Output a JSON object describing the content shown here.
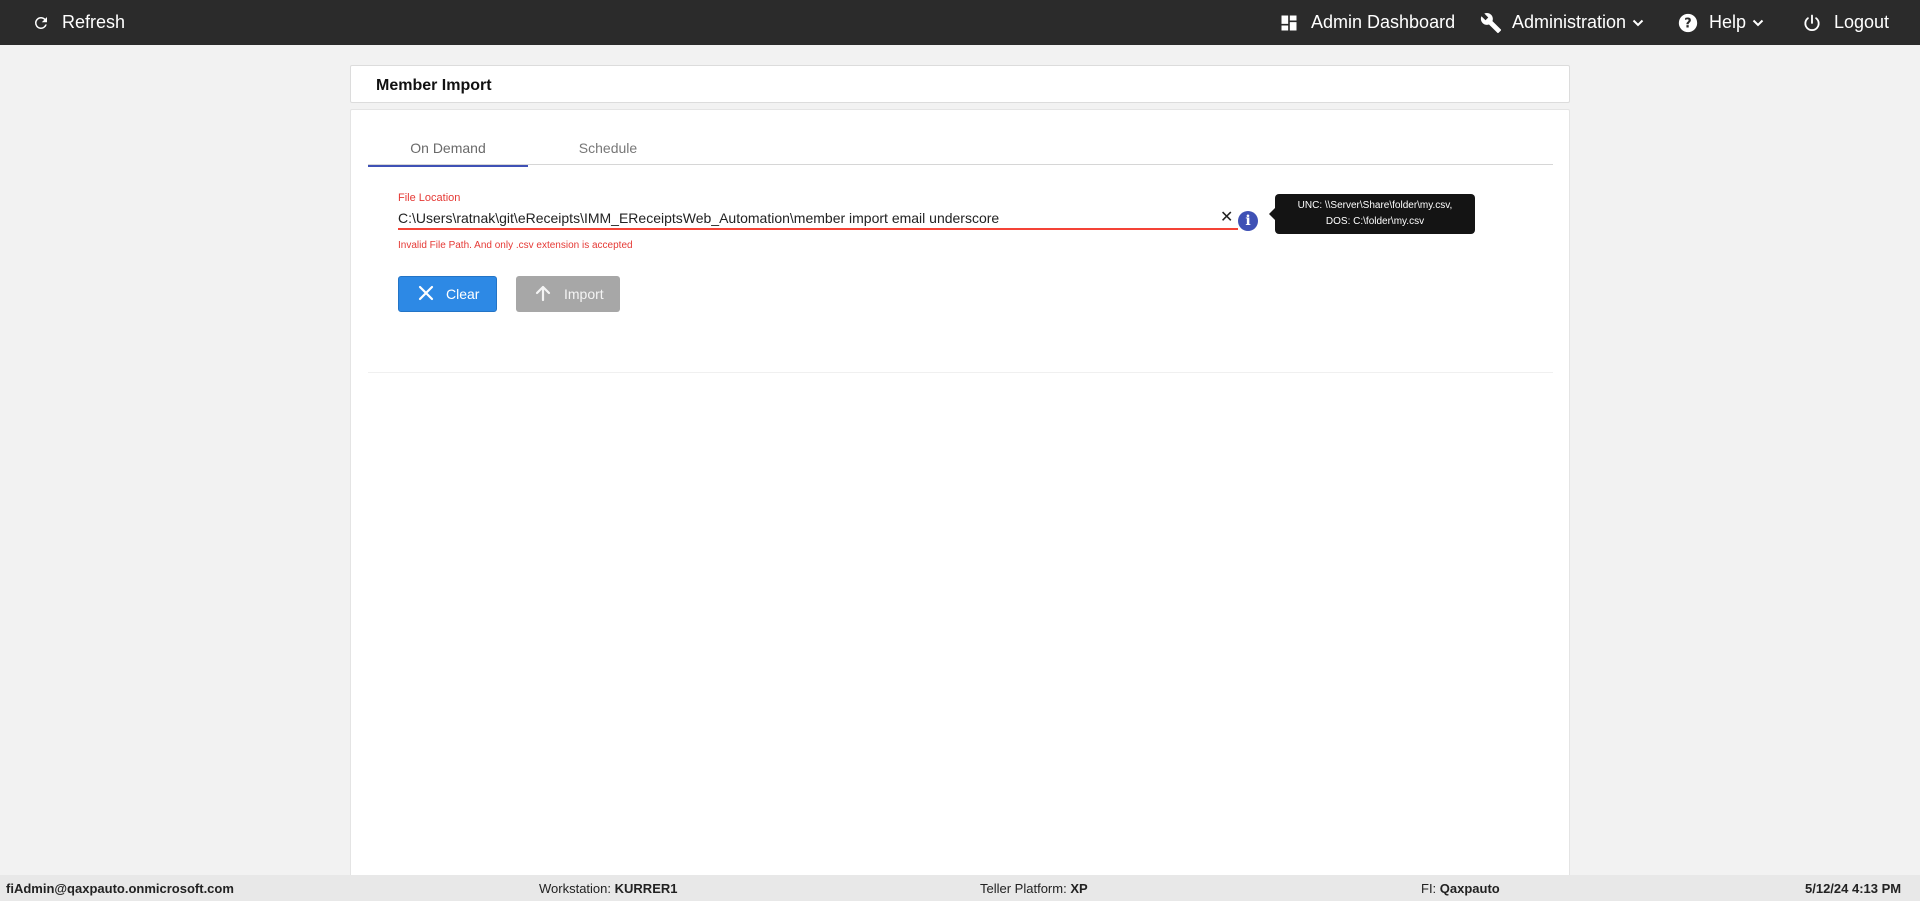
{
  "topbar": {
    "refresh_label": "Refresh",
    "dashboard_label": "Admin Dashboard",
    "administration_label": "Administration",
    "help_label": "Help",
    "logout_label": "Logout"
  },
  "page": {
    "title": "Member Import"
  },
  "tabs": [
    {
      "label": "On Demand",
      "active": true
    },
    {
      "label": "Schedule",
      "active": false
    }
  ],
  "form": {
    "file_location_label": "File Location",
    "file_location_value": "C:\\Users\\ratnak\\git\\eReceipts\\IMM_EReceiptsWeb_Automation\\member import email underscore",
    "clear_glyph": "✕",
    "info_glyph": "i",
    "error_message": "Invalid File Path. And only .csv extension is accepted",
    "tooltip_line1": "UNC: \\\\Server\\Share\\folder\\my.csv,",
    "tooltip_line2": "DOS: C:\\folder\\my.csv",
    "clear_button_label": "Clear",
    "import_button_label": "Import"
  },
  "statusbar": {
    "user": "fiAdmin@qaxpauto.onmicrosoft.com",
    "workstation_label": "Workstation:",
    "workstation_value": "KURRER1",
    "teller_platform_label": "Teller Platform:",
    "teller_platform_value": "XP",
    "fi_label": "FI:",
    "fi_value": "Qaxpauto",
    "datetime": "5/12/24 4:13 PM"
  },
  "colors": {
    "topbar_bg": "#2b2b2b",
    "tab_active_underline": "#3f51b5",
    "error_red": "#e53935",
    "clear_button_bg": "#2d89e5",
    "import_button_bg": "#a7a7a7",
    "info_icon_bg": "#3f51b5"
  },
  "icons": {
    "refresh": "refresh-icon",
    "dashboard": "dashboard-icon",
    "administration": "wrench-icon",
    "help": "help-circle-icon",
    "logout": "power-icon",
    "clear": "close-icon",
    "import": "arrow-up-icon",
    "info": "info-icon"
  }
}
